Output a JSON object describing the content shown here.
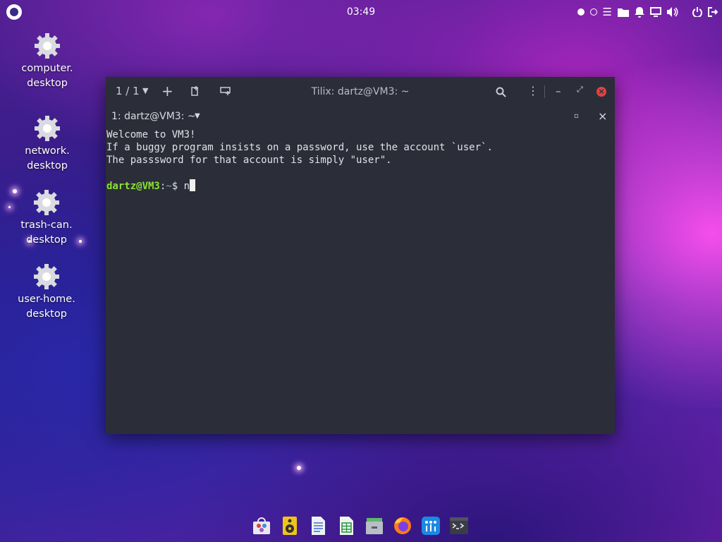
{
  "topbar": {
    "clock": "03:49",
    "tray_icons": [
      "workspace-active-icon",
      "workspace-inactive-icon",
      "menu-icon",
      "folder-icon",
      "notifications-icon",
      "display-icon",
      "volume-icon",
      "power-icon",
      "logout-icon"
    ]
  },
  "desktop_icons": [
    {
      "line1": "computer.",
      "line2": "desktop"
    },
    {
      "line1": "network.",
      "line2": "desktop"
    },
    {
      "line1": "trash-can.",
      "line2": "desktop"
    },
    {
      "line1": "user-home.",
      "line2": "desktop"
    }
  ],
  "window": {
    "title": "Tilix: dartz@VM3: ~",
    "tab_counter": "1 / 1",
    "session_label": "1: dartz@VM3: ~"
  },
  "terminal": {
    "line1": "Welcome to VM3!",
    "line2": "If a buggy program insists on a password, use the account `user`.",
    "line3": "The passsword for that account is simply \"user\".",
    "prompt_user": "dartz@VM3",
    "prompt_sep": ":",
    "prompt_path": "~",
    "prompt_symbol": "$ ",
    "input": "n"
  },
  "dock": [
    "software-center-icon",
    "music-player-icon",
    "text-document-icon",
    "spreadsheet-icon",
    "file-manager-icon",
    "firefox-icon",
    "app-grid-icon",
    "terminal-icon"
  ],
  "colors": {
    "terminal_bg": "#2b2e38",
    "prompt_user": "#8ae234",
    "prompt_path": "#7aa6da",
    "close_button": "#e0413f"
  }
}
